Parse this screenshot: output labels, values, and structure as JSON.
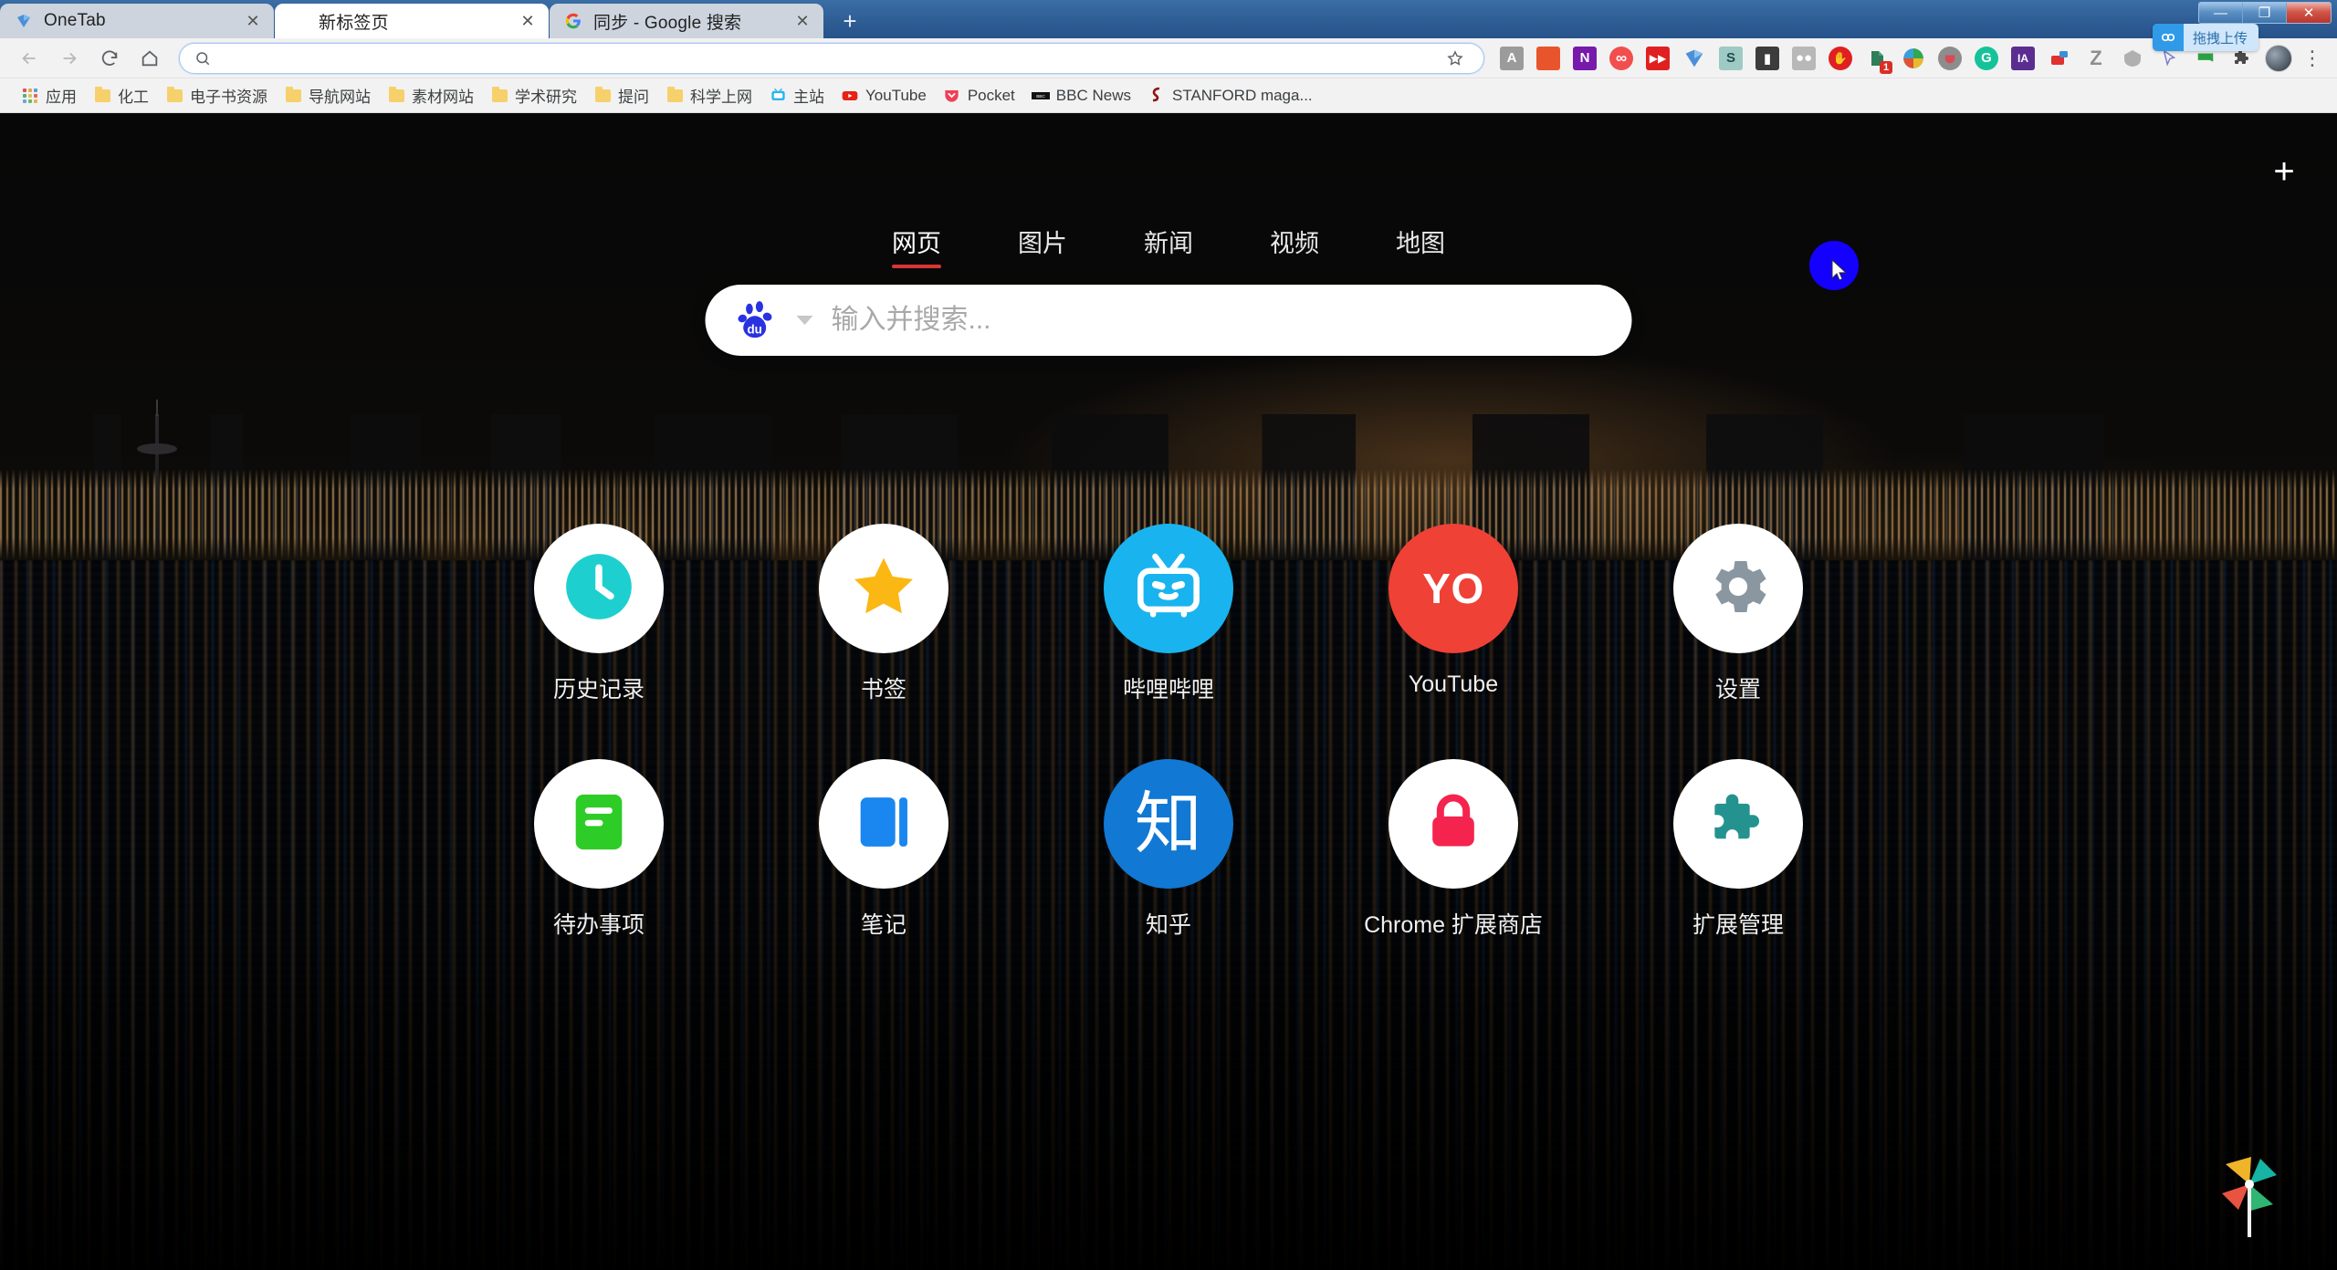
{
  "window": {
    "controls": [
      {
        "name": "minimize",
        "glyph": "—"
      },
      {
        "name": "restore",
        "glyph": "❐"
      },
      {
        "name": "close",
        "glyph": "✕"
      }
    ]
  },
  "tabs": [
    {
      "title": "OneTab",
      "favicon": "onetab-icon",
      "active": false,
      "close_glyph": "✕"
    },
    {
      "title": "新标签页",
      "favicon": "none",
      "active": true,
      "close_glyph": "✕"
    },
    {
      "title": "同步 - Google 搜索",
      "favicon": "google-icon",
      "active": false,
      "close_glyph": "✕"
    }
  ],
  "new_tab_button": "+",
  "toolbar": {
    "back": "back-arrow-icon",
    "forward": "forward-arrow-icon",
    "reload": "reload-icon",
    "home": "home-icon",
    "omnibox": {
      "value": "",
      "placeholder": "",
      "search_icon": "search-icon"
    },
    "bookmark_star": "star-icon",
    "menu": "kebab-menu-icon",
    "extensions": [
      {
        "name": "adobe-acrobat-extension",
        "label": "A",
        "color": "#9b9b9b",
        "shape": "square"
      },
      {
        "name": "microsoft-office-extension",
        "label": "",
        "color": "#e8552d",
        "shape": "square"
      },
      {
        "name": "onenote-clipper-extension",
        "label": "N",
        "color": "#7719aa",
        "shape": "square"
      },
      {
        "name": "infinity-newtab-extension",
        "label": "∞",
        "color": "#f24e4e",
        "shape": "circle"
      },
      {
        "name": "fast-forward-extension",
        "label": "⏩",
        "color": "#e02020",
        "shape": "square"
      },
      {
        "name": "onetab-extension",
        "label": "",
        "color": "#3b78d8",
        "shape": "plain"
      },
      {
        "name": "scribd-extension",
        "label": "S",
        "color": "#9ec9c4",
        "shape": "square"
      },
      {
        "name": "zotero-connector-extension",
        "label": "",
        "color": "#3c3c3c",
        "shape": "square"
      },
      {
        "name": "pocket-list-extension",
        "label": "",
        "color": "#b8b8b8",
        "shape": "square"
      },
      {
        "name": "adblock-extension",
        "label": "✋",
        "color": "#e02020",
        "shape": "circle"
      },
      {
        "name": "evernote-clipper-extension",
        "label": "",
        "color": "#2e7d5b",
        "shape": "plain",
        "badge": "1"
      },
      {
        "name": "internet-download-manager-extension",
        "label": "",
        "color": "#2f8f3f",
        "shape": "plain"
      },
      {
        "name": "pocket-extension",
        "label": "",
        "color": "#7a7a7a",
        "shape": "circle"
      },
      {
        "name": "grammarly-extension",
        "label": "G",
        "color": "#15c39a",
        "shape": "circle"
      },
      {
        "name": "internet-archive-extension",
        "label": "IA",
        "color": "#5b2d91",
        "shape": "square"
      },
      {
        "name": "youdao-dictionary-extension",
        "label": "",
        "color": "#e03030",
        "shape": "plain"
      },
      {
        "name": "zhihu-extension",
        "label": "Z",
        "color": "#8e8e8e",
        "shape": "plain"
      },
      {
        "name": "adguard-extension",
        "label": "",
        "color": "#9a9a9a",
        "shape": "plain"
      },
      {
        "name": "cursor-pointer-extension",
        "label": "",
        "color": "#6d6dc8",
        "shape": "plain"
      },
      {
        "name": "wechat-extension",
        "label": "",
        "color": "#2ba245",
        "shape": "plain"
      },
      {
        "name": "extensions-puzzle-icon",
        "label": "",
        "color": "#4a4a4a",
        "shape": "plain"
      }
    ],
    "profile_avatar": "user-avatar",
    "drag_upload_tip": {
      "label": "拖拽上传",
      "icon": "cloud-upload-icon",
      "bg": "#cfe6fb",
      "icon_bg": "#2f9ae8"
    }
  },
  "bookmarks": [
    {
      "label": "应用",
      "icon": "apps-grid-icon"
    },
    {
      "label": "化工",
      "icon": "folder-icon"
    },
    {
      "label": "电子书资源",
      "icon": "folder-icon"
    },
    {
      "label": "导航网站",
      "icon": "folder-icon"
    },
    {
      "label": "素材网站",
      "icon": "folder-icon"
    },
    {
      "label": "学术研究",
      "icon": "folder-icon"
    },
    {
      "label": "提问",
      "icon": "folder-icon"
    },
    {
      "label": "科学上网",
      "icon": "folder-icon"
    },
    {
      "label": "主站",
      "icon": "bilibili-icon"
    },
    {
      "label": "YouTube",
      "icon": "youtube-icon"
    },
    {
      "label": "Pocket",
      "icon": "pocket-icon"
    },
    {
      "label": "BBC News",
      "icon": "bbc-icon"
    },
    {
      "label": "STANFORD maga...",
      "icon": "stanford-icon"
    }
  ],
  "newtab": {
    "add_shortcut_button": "+",
    "search_tabs": [
      {
        "label": "网页",
        "active": true
      },
      {
        "label": "图片",
        "active": false
      },
      {
        "label": "新闻",
        "active": false
      },
      {
        "label": "视频",
        "active": false
      },
      {
        "label": "地图",
        "active": false
      }
    ],
    "search": {
      "engine": "baidu",
      "engine_logo_text": "du",
      "value": "",
      "placeholder": "输入并搜索...",
      "caret": "chevron-down-icon"
    },
    "shortcuts": [
      {
        "label": "历史记录",
        "icon": "clock-icon",
        "circle_bg": "#ffffff",
        "accent": "#1ecfcf",
        "glyph_type": "clock"
      },
      {
        "label": "书签",
        "icon": "star-icon",
        "circle_bg": "#ffffff",
        "accent": "#fbb713",
        "glyph_type": "star"
      },
      {
        "label": "哔哩哔哩",
        "icon": "bilibili-tv-icon",
        "circle_bg": "#19b4f0",
        "accent": "#ffffff",
        "glyph_type": "tv"
      },
      {
        "label": "YouTube",
        "icon": "youtube-icon",
        "circle_bg": "#ef4136",
        "accent": "#ffffff",
        "glyph_type": "text",
        "text": "YO"
      },
      {
        "label": "设置",
        "icon": "gear-icon",
        "circle_bg": "#ffffff",
        "accent": "#8a97a0",
        "glyph_type": "gear"
      },
      {
        "label": "待办事项",
        "icon": "todo-list-icon",
        "circle_bg": "#ffffff",
        "accent": "#2ecc26",
        "glyph_type": "todo"
      },
      {
        "label": "笔记",
        "icon": "notebook-icon",
        "circle_bg": "#ffffff",
        "accent": "#1a86f0",
        "glyph_type": "notebook"
      },
      {
        "label": "知乎",
        "icon": "zhihu-icon",
        "circle_bg": "#1178d4",
        "accent": "#ffffff",
        "glyph_type": "text-zh",
        "text": "知"
      },
      {
        "label": "Chrome 扩展商店",
        "icon": "lock-icon",
        "circle_bg": "#ffffff",
        "accent": "#f4244f",
        "glyph_type": "lock"
      },
      {
        "label": "扩展管理",
        "icon": "puzzle-icon",
        "circle_bg": "#ffffff",
        "accent": "#24938f",
        "glyph_type": "puzzle"
      }
    ],
    "pinwheel_widget": "pinwheel-icon"
  }
}
